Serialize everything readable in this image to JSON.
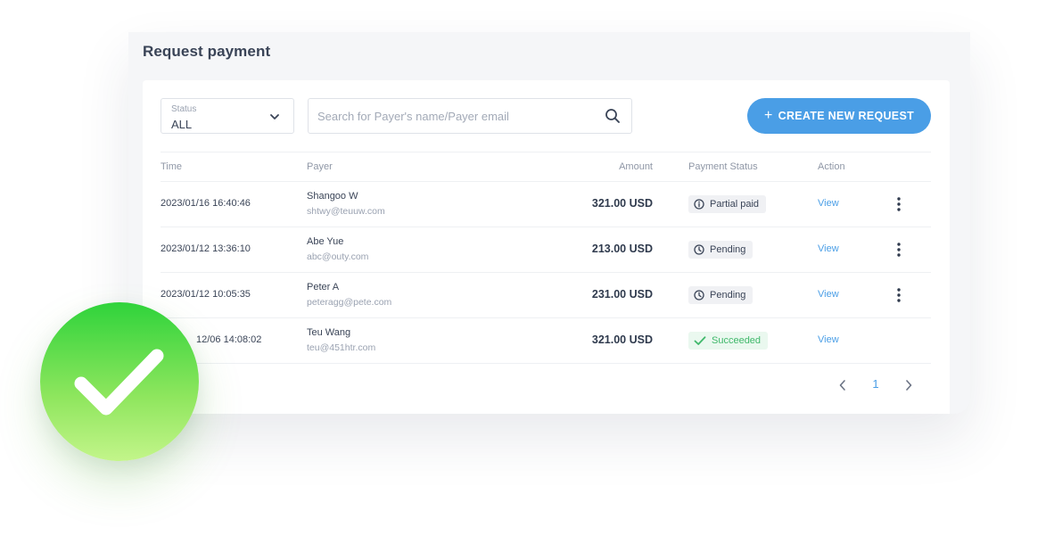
{
  "page": {
    "title": "Request payment"
  },
  "filters": {
    "status_label": "Status",
    "status_value": "ALL",
    "search_placeholder": "Search for Payer's name/Payer email"
  },
  "actions": {
    "create_label": "CREATE NEW REQUEST"
  },
  "table": {
    "headers": {
      "time": "Time",
      "payer": "Payer",
      "amount": "Amount",
      "status": "Payment Status",
      "action": "Action"
    },
    "rows": [
      {
        "time": "2023/01/16 16:40:46",
        "name": "Shangoo W",
        "email": "shtwy@teuuw.com",
        "amount": "321.00 USD",
        "status": "Partial paid",
        "status_icon": "info-icon",
        "action": "View"
      },
      {
        "time": "2023/01/12 13:36:10",
        "name": "Abe Yue",
        "email": "abc@outy.com",
        "amount": "213.00 USD",
        "status": "Pending",
        "status_icon": "clock-icon",
        "action": "View"
      },
      {
        "time": "2023/01/12 10:05:35",
        "name": "Peter A",
        "email": "peteragg@pete.com",
        "amount": "231.00 USD",
        "status": "Pending",
        "status_icon": "clock-icon",
        "action": "View"
      },
      {
        "time": "12/06 14:08:02",
        "name": "Teu Wang",
        "email": "teu@451htr.com",
        "amount": "321.00 USD",
        "status": "Succeeded",
        "status_icon": "check-icon",
        "action": "View"
      }
    ]
  },
  "pagination": {
    "current_page": "1"
  },
  "colors": {
    "accent": "#4a9ee6",
    "success": "#3fb86a",
    "badge_green_top": "#2fd33b",
    "badge_green_bottom": "#c3f58a"
  }
}
